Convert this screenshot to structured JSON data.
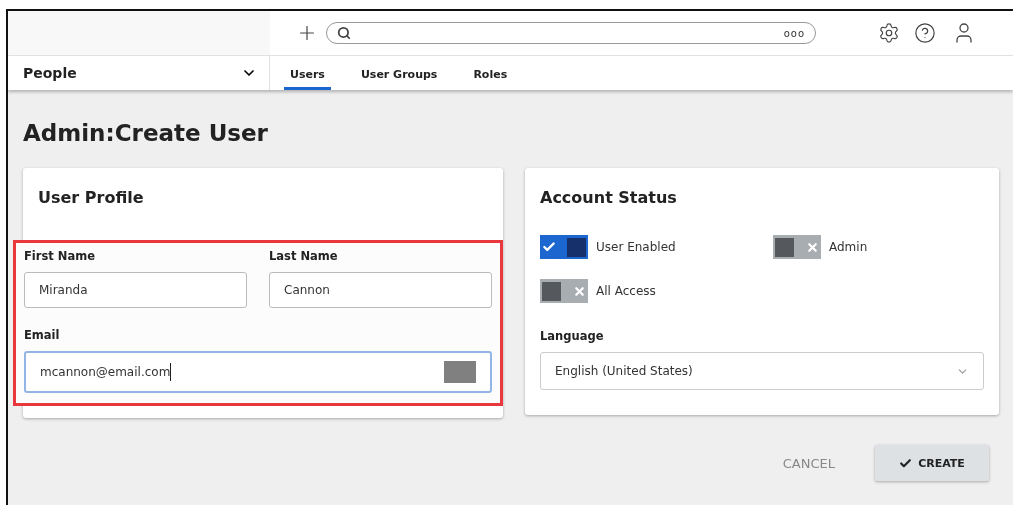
{
  "header": {
    "module": "People",
    "tabs": [
      {
        "label": "Users",
        "selected": true
      },
      {
        "label": "User Groups",
        "selected": false
      },
      {
        "label": "Roles",
        "selected": false
      }
    ],
    "search": {
      "more": "ooo"
    }
  },
  "title": "Admin:Create User",
  "profile": {
    "title": "User Profile",
    "first_name": {
      "label": "First Name",
      "value": "Miranda"
    },
    "last_name": {
      "label": "Last Name",
      "value": "Cannon"
    },
    "email": {
      "label": "Email",
      "value": "mcannon@email.com",
      "focused": true
    }
  },
  "status": {
    "title": "Account Status",
    "toggles": [
      {
        "label": "User Enabled",
        "on": true
      },
      {
        "label": "Admin",
        "on": false
      },
      {
        "label": "All Access",
        "on": false
      }
    ],
    "language": {
      "label": "Language",
      "value": "English (United States)"
    }
  },
  "actions": {
    "cancel": "CANCEL",
    "create": "CREATE"
  }
}
